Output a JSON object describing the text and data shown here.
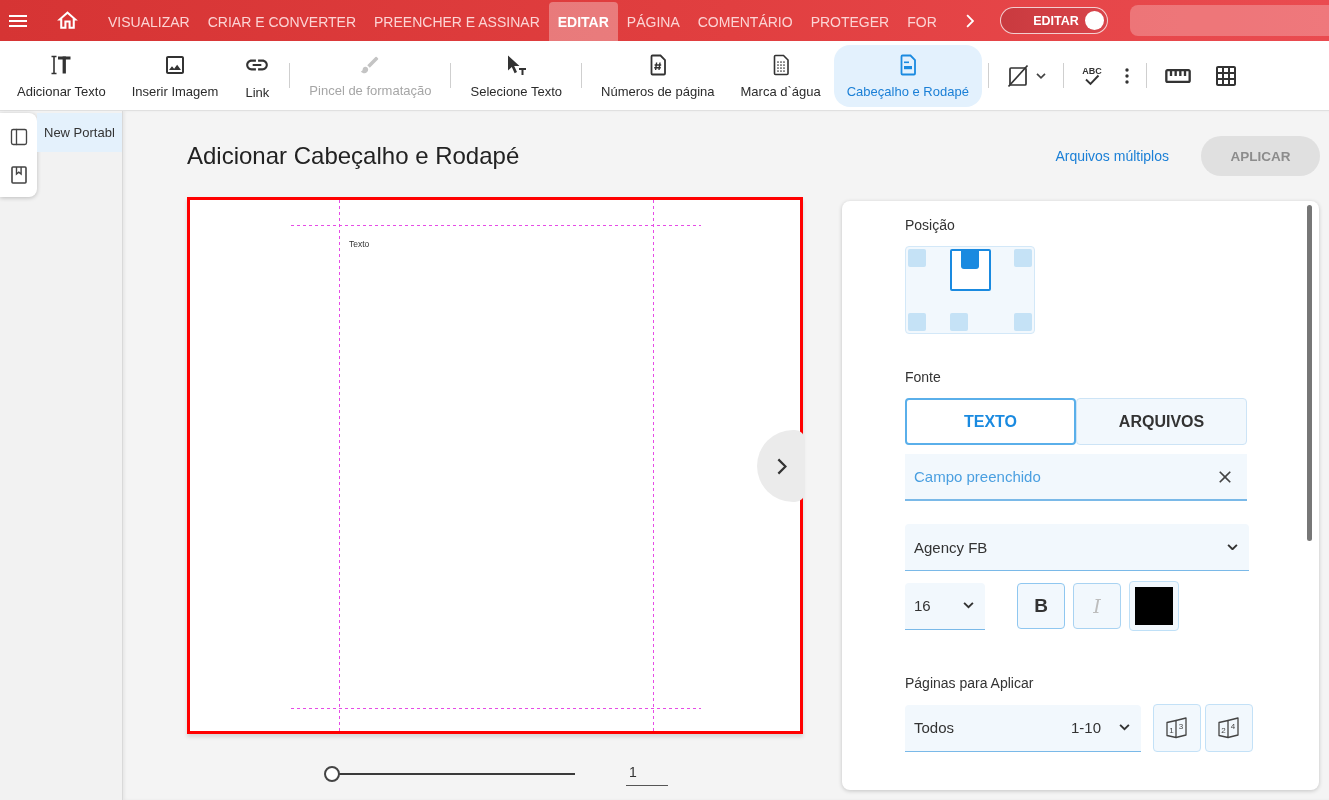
{
  "top_bar": {
    "tabs": [
      {
        "label": "VISUALIZAR",
        "selected": false
      },
      {
        "label": "CRIAR E CONVERTER",
        "selected": false
      },
      {
        "label": "PREENCHER E ASSINAR",
        "selected": false
      },
      {
        "label": "EDITAR",
        "selected": true
      },
      {
        "label": "PÁGINA",
        "selected": false
      },
      {
        "label": "COMENTÁRIO",
        "selected": false
      },
      {
        "label": "PROTEGER",
        "selected": false
      },
      {
        "label": "FOR",
        "selected": false
      }
    ],
    "mode_toggle": {
      "label": "EDITAR",
      "on": true
    }
  },
  "toolbar": {
    "groups": [
      [
        {
          "kind": "add_text",
          "label": "Adicionar Texto",
          "selected": false,
          "disabled": false
        },
        {
          "kind": "image",
          "label": "Inserir Imagem",
          "selected": false,
          "disabled": false
        },
        {
          "kind": "link",
          "label": "Link",
          "selected": false,
          "disabled": false
        }
      ],
      [
        {
          "kind": "brush",
          "label": "Pincel de formatação",
          "selected": false,
          "disabled": true
        }
      ],
      [
        {
          "kind": "select_text",
          "label": "Selecione Texto",
          "selected": false,
          "disabled": false
        }
      ],
      [
        {
          "kind": "page_numbers",
          "label": "Números de página",
          "selected": false,
          "disabled": false
        },
        {
          "kind": "watermark",
          "label": "Marca d`água",
          "selected": false,
          "disabled": false
        },
        {
          "kind": "header_footer",
          "label": "Cabeçalho e Rodapé",
          "selected": true,
          "disabled": false
        }
      ],
      [
        {
          "kind": "no_fill",
          "selected": false,
          "disabled": false
        }
      ],
      [
        {
          "kind": "spellcheck",
          "icon_text": "ABC",
          "selected": false,
          "disabled": false
        },
        {
          "kind": "more",
          "selected": false,
          "disabled": false
        }
      ],
      [
        {
          "kind": "ruler",
          "selected": false,
          "disabled": false
        },
        {
          "kind": "table",
          "selected": false,
          "disabled": false
        }
      ]
    ]
  },
  "document_tabs": [
    {
      "label": "New Portabl",
      "selected": true
    }
  ],
  "panel": {
    "title": "Adicionar Cabeçalho e Rodapé",
    "multi_files_link": "Arquivos múltiplos",
    "apply_button": {
      "label": "APLICAR",
      "disabled": true
    }
  },
  "preview": {
    "header_text": "Texto",
    "zoom_slider": {
      "level": 0
    },
    "page_field": {
      "value": "1"
    }
  },
  "settings": {
    "position_label": "Posição",
    "positions": [
      {
        "selected": false
      },
      {
        "selected": true
      },
      {
        "selected": false
      },
      {
        "selected": false
      },
      {
        "selected": false
      },
      {
        "selected": false
      }
    ],
    "font_label": "Fonte",
    "source_tabs": [
      {
        "label": "TEXTO",
        "selected": true
      },
      {
        "label": "ARQUIVOS",
        "selected": false
      }
    ],
    "text_field": {
      "value": "Campo preenchido"
    },
    "font_select": {
      "value": "Agency FB"
    },
    "size_select": {
      "value": "16"
    },
    "bold_button": {
      "label": "B",
      "disabled": false
    },
    "italic_button": {
      "label": "I",
      "disabled": true
    },
    "color": "#000000",
    "pages_label": "Páginas para Aplicar",
    "pages_select": {
      "value": "Todos",
      "range": "1-10"
    },
    "page_set_buttons": [
      {
        "digits": [
          "1",
          "3"
        ]
      },
      {
        "digits": [
          "2",
          "4"
        ]
      }
    ]
  }
}
